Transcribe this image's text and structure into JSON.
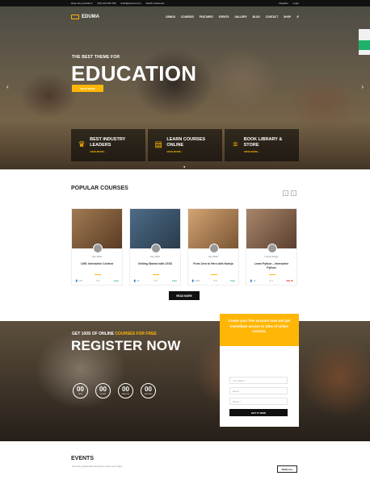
{
  "topbar": {
    "question": "Have any question?",
    "phone": "(00) 123 456 789",
    "email": "hello@eduma.com",
    "location": "Sadhu Anacenter",
    "register": "Register",
    "login": "Login"
  },
  "nav": {
    "logo": "EDUMA",
    "items": [
      "DEMOS",
      "COURSES",
      "FEATURES",
      "EVENTS",
      "GALLERY",
      "BLOG",
      "CONTACT",
      "SHOP"
    ]
  },
  "hero": {
    "subtitle": "THE BEST THEME FOR",
    "title": "EDUCATION",
    "button": "READ MORE",
    "features": [
      {
        "title": "BEST INDUSTRY LEADERS",
        "more": "VIEW MORE ›"
      },
      {
        "title": "LEARN COURSES ONLINE",
        "more": "VIEW MORE ›"
      },
      {
        "title": "BOOK LIBRARY & STORE",
        "more": "VIEW MORE ›"
      }
    ]
  },
  "popular": {
    "title": "POPULAR COURSES",
    "courses": [
      {
        "teacher": "Gary Miller",
        "name": "LMS: Interactive Content",
        "students": "253",
        "comments": "2",
        "price": "Free",
        "img": "#7b5a3a"
      },
      {
        "teacher": "Gary Miller",
        "name": "Getting Started with LESS",
        "students": "68",
        "comments": "3",
        "price": "Free",
        "img": "#3b556c"
      },
      {
        "teacher": "Gary Miller",
        "name": "From Zero to Hero with Nodejs",
        "students": "1050",
        "comments": "5",
        "price": "Free",
        "img": "#b98b5a"
      },
      {
        "teacher": "Celeste Rugge",
        "name": "Learn Python – Interactive Python",
        "students": "45",
        "comments": "4",
        "price": "$69.00",
        "img": "#8c6a4f"
      }
    ],
    "read_more": "READ MORE"
  },
  "register": {
    "subtitle_a": "GET 100S OF ONLINE",
    "subtitle_b": "COURSES FOR FREE",
    "title": "REGISTER NOW",
    "counts": [
      {
        "n": "00",
        "l": "DAYS"
      },
      {
        "n": "00",
        "l": "HOURS"
      },
      {
        "n": "00",
        "l": "MINUTES"
      },
      {
        "n": "00",
        "l": "SECONDS"
      }
    ],
    "form_head": "Create your free account now and get immediate access to 100s of online courses.",
    "fields": [
      "Your Name *",
      "Email *",
      "Phone *"
    ],
    "button": "GET IT NOW"
  },
  "events": {
    "title": "EVENTS",
    "subtitle": "Upcoming Education Events to feed your brain.",
    "view_all": "VIEW ALL"
  },
  "colors": {
    "accent": "#ffb606",
    "dark": "#111111",
    "green": "#1fb16b"
  }
}
